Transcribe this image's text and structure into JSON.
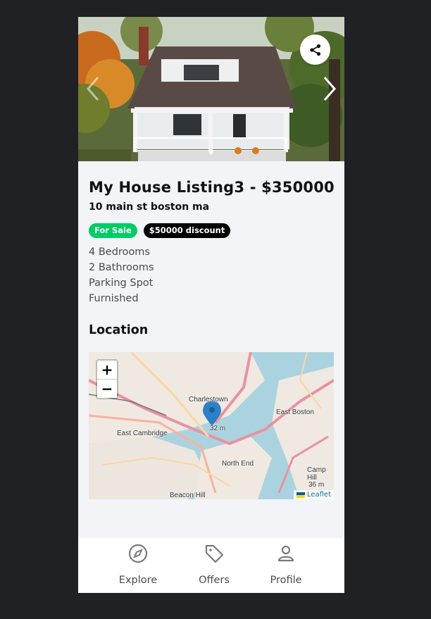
{
  "listing": {
    "title": "My House Listing3 - $350000",
    "address": "10 main st boston ma",
    "badges": {
      "sale": "For Sale",
      "discount": "$50000 discount"
    },
    "features": [
      "4 Bedrooms",
      "2 Bathrooms",
      "Parking Spot",
      "Furnished"
    ],
    "location_title": "Location"
  },
  "map": {
    "zoom_in": "+",
    "zoom_out": "−",
    "attribution": "Leaflet",
    "labels": {
      "charlestown": "Charlestown",
      "east_boston": "East Boston",
      "east_cambridge": "East Cambridge",
      "north_end": "North End",
      "beacon_hill": "Beacon Hill",
      "camp_hill": "Camp Hill",
      "elev_32": "32 m",
      "elev_36": "36 m"
    }
  },
  "nav": {
    "items": [
      {
        "label": "Explore",
        "icon": "compass-icon"
      },
      {
        "label": "Offers",
        "icon": "tag-icon"
      },
      {
        "label": "Profile",
        "icon": "person-icon"
      }
    ]
  },
  "colors": {
    "sale_badge": "#00cc66",
    "discount_badge": "#000000",
    "marker": "#2a81cb",
    "page_background": "#202124",
    "card_background": "#f2f4f8"
  }
}
